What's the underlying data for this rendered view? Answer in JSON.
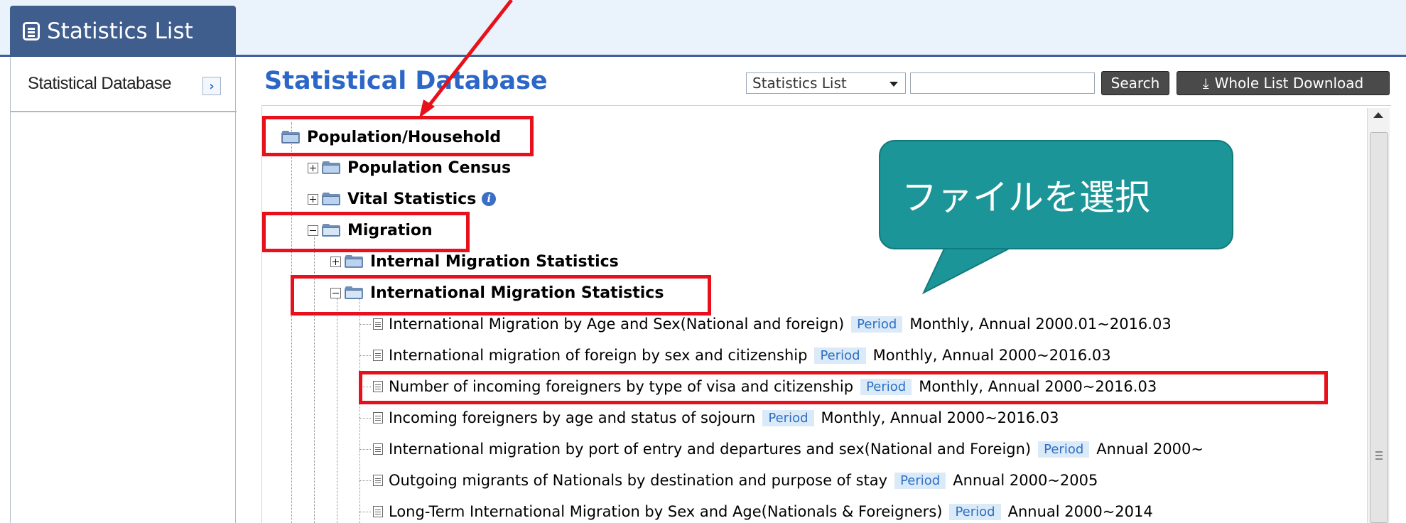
{
  "header": {
    "tab_label": "Statistics List"
  },
  "sidebar": {
    "item_label": "Statistical Database"
  },
  "main": {
    "title": "Statistical Database",
    "list_select_value": "Statistics List",
    "search_placeholder": "",
    "search_label": "Search",
    "download_label": "Whole List Download"
  },
  "tree": {
    "population_household": "Population/Household",
    "population_census": "Population Census",
    "vital_statistics": "Vital Statistics",
    "migration": "Migration",
    "internal_migration": "Internal Migration Statistics",
    "international_migration": "International Migration Statistics",
    "leaves": [
      {
        "title": "International Migration by Age and Sex(National and foreign)",
        "period": "Period",
        "freq": "Monthly, Annual 2000.01~2016.03"
      },
      {
        "title": "International migration of foreign by sex and citizenship",
        "period": "Period",
        "freq": "Monthly, Annual 2000~2016.03"
      },
      {
        "title": "Number of incoming foreigners by type of visa and citizenship",
        "period": "Period",
        "freq": "Monthly, Annual 2000~2016.03"
      },
      {
        "title": "Incoming foreigners by age and status of sojourn",
        "period": "Period",
        "freq": "Monthly, Annual 2000~2016.03"
      },
      {
        "title": "International migration by port of entry and departures and sex(National and Foreign)",
        "period": "Period",
        "freq": "Annual 2000~"
      },
      {
        "title": "Outgoing migrants of Nationals by destination and purpose of stay",
        "period": "Period",
        "freq": "Annual 2000~2005"
      },
      {
        "title": "Long-Term International Migration by Sex and Age(Nationals & Foreigners)",
        "period": "Period",
        "freq": "Annual 2000~2014"
      }
    ]
  },
  "callout": {
    "text": "ファイルを選択"
  },
  "colors": {
    "annotation_red": "#e8101b",
    "callout_teal": "#1b9597",
    "title_blue": "#2c67c7",
    "tab_navy": "#3f5d8d"
  }
}
